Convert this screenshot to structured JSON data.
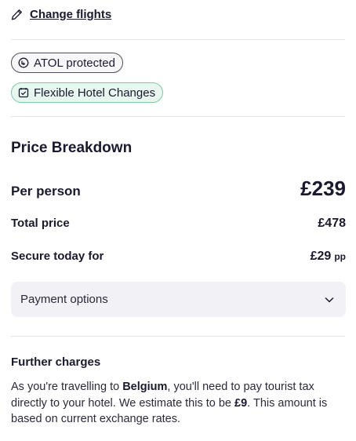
{
  "change_flights": {
    "label": "Change flights",
    "icon": "pencil-icon"
  },
  "badges": [
    {
      "label": "ATOL protected",
      "icon": "atol-icon"
    },
    {
      "label": "Flexible Hotel Changes",
      "icon": "calendar-check-icon"
    }
  ],
  "price_breakdown": {
    "title": "Price Breakdown",
    "per_person": {
      "label": "Per person",
      "value": "£239"
    },
    "total": {
      "label": "Total price",
      "value": "£478"
    },
    "secure": {
      "label": "Secure today for",
      "value": "£29",
      "unit": "pp"
    }
  },
  "payment_options": {
    "label": "Payment options",
    "icon": "chevron-down-icon"
  },
  "further_charges": {
    "title": "Further charges",
    "text_1": "As you're travelling to ",
    "destination": "Belgium",
    "text_2": ", you'll need to pay tourist tax directly to your hotel. We estimate this to be ",
    "amount": "£9",
    "text_3": ". This amount is based on current exchange rates."
  },
  "colors": {
    "text": "#1a1a2e",
    "divider": "#e3e3ea",
    "atol_border": "#505062",
    "flex_bg": "#e7f6ef",
    "flex_border": "#7fc9a9",
    "payment_bg": "#f1f1f6"
  }
}
